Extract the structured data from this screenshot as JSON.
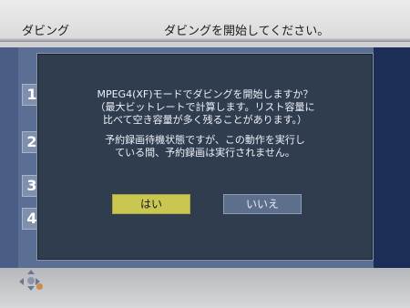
{
  "header": {
    "app_title": "ダビング",
    "status_message": "ダビングを開始してください。"
  },
  "list": {
    "items": [
      "1",
      "2",
      "3",
      "4"
    ]
  },
  "dialog": {
    "lines": [
      "MPEG4(XF)モードでダビングを開始しますか？",
      "（最大ビットレートで計算します。リスト容量に",
      "比べて空き容量が多く残ることがあります。）",
      "予約録画待機状態ですが、この動作を実行し",
      "ている間、予約録画は実行されません。"
    ],
    "yes_label": "はい",
    "no_label": "いいえ"
  },
  "colors": {
    "screen_bg": "#5b6e93",
    "dialog_bg": "#2f3d4f",
    "yes_button": "#c9c751",
    "no_button": "#5e6f8e"
  }
}
